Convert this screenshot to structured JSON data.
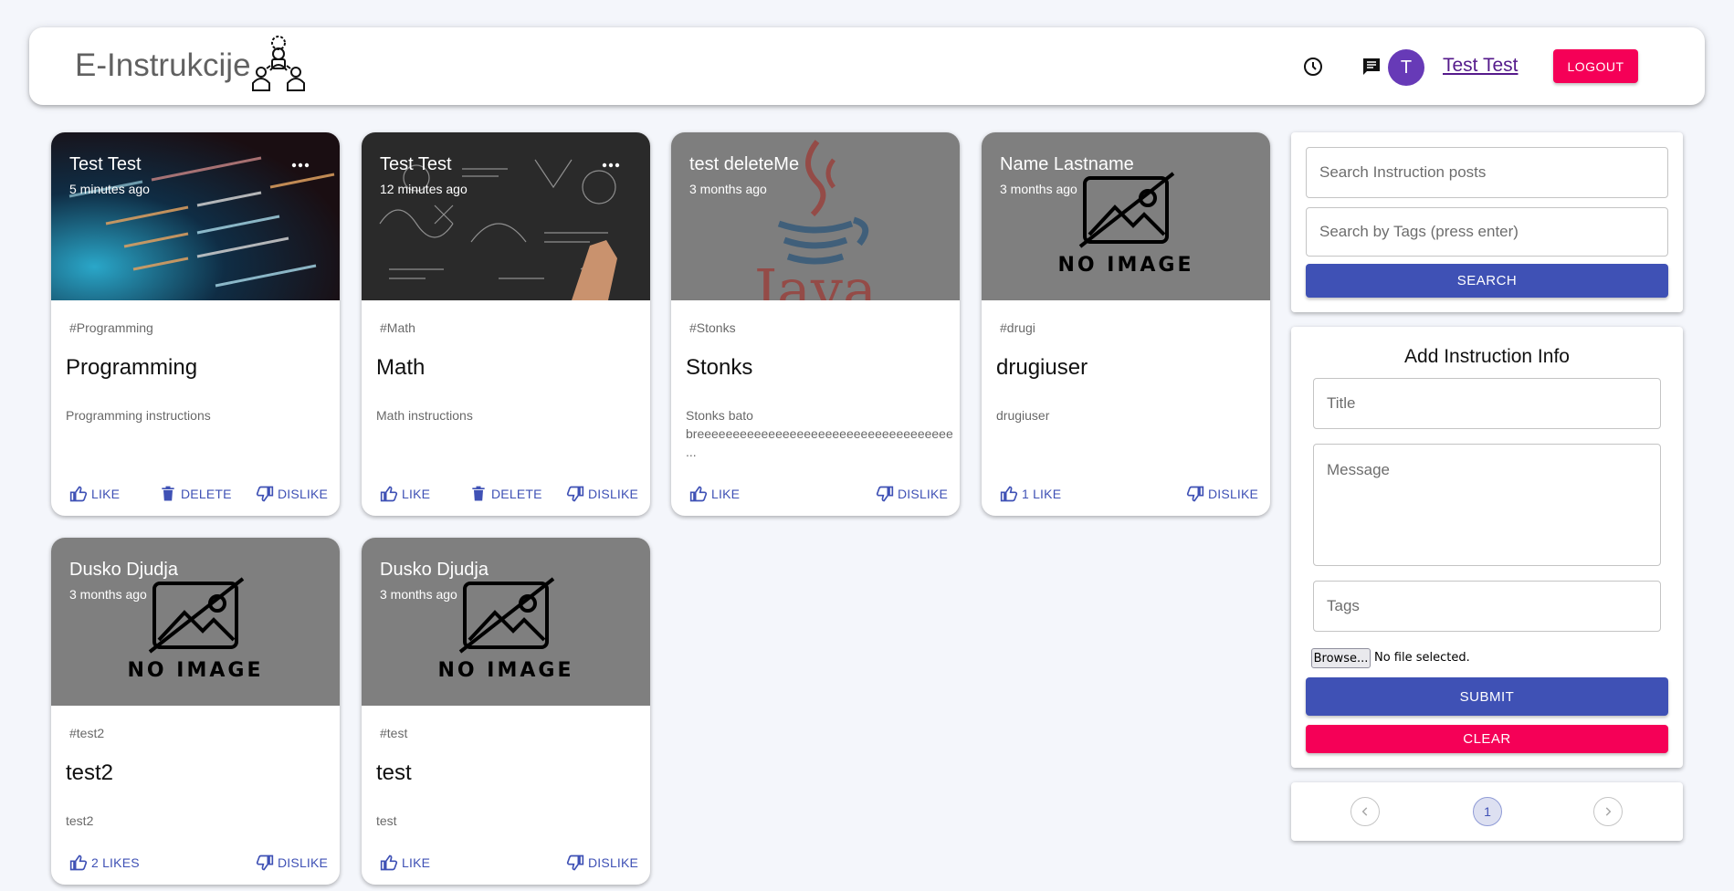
{
  "header": {
    "brand": "E-Instrukcije",
    "avatar_letter": "T",
    "username": "Test Test",
    "logout": "LOGOUT"
  },
  "posts": [
    {
      "author": "Test Test",
      "time": "5 minutes ago",
      "tags": "#Programming",
      "title": "Programming",
      "message": "Programming instructions",
      "like": "LIKE",
      "delete": "DELETE",
      "dislike": "DISLIKE",
      "image": "code-photo"
    },
    {
      "author": "Test Test",
      "time": "12 minutes ago",
      "tags": "#Math",
      "title": "Math",
      "message": "Math instructions",
      "like": "LIKE",
      "delete": "DELETE",
      "dislike": "DISLIKE",
      "image": "chalkboard-photo"
    },
    {
      "author": "test deleteMe",
      "time": "3 months ago",
      "tags": "#Stonks",
      "title": "Stonks",
      "message": "Stonks bato\nbreeeeeeeeeeeeeeeeeeeeeeeeeeeeeeeeeeee\n...",
      "like": "LIKE",
      "dislike": "DISLIKE",
      "image": "java-logo"
    },
    {
      "author": "Name Lastname",
      "time": "3 months ago",
      "tags": "#drugi",
      "title": "drugiuser",
      "message": "drugiuser",
      "like": "1 LIKE",
      "dislike": "DISLIKE",
      "image": "no-image"
    },
    {
      "author": "Dusko Djudja",
      "time": "3 months ago",
      "tags": "#test2",
      "title": "test2",
      "message": "test2",
      "like": "2 LIKES",
      "dislike": "DISLIKE",
      "image": "no-image"
    },
    {
      "author": "Dusko Djudja",
      "time": "3 months ago",
      "tags": "#test",
      "title": "test",
      "message": "test",
      "like": "LIKE",
      "dislike": "DISLIKE",
      "image": "no-image"
    }
  ],
  "no_image_text": "NO IMAGE",
  "java_text": "Java",
  "search": {
    "posts_placeholder": "Search Instruction posts",
    "tags_placeholder": "Search by Tags (press enter)",
    "button": "SEARCH"
  },
  "form": {
    "title": "Add Instruction Info",
    "title_placeholder": "Title",
    "message_placeholder": "Message",
    "tags_placeholder": "Tags",
    "browse": "Browse...",
    "no_file": "No file selected.",
    "submit": "SUBMIT",
    "clear": "CLEAR"
  },
  "pagination": {
    "current": "1"
  },
  "colors": {
    "primary": "#3f51b5",
    "secondary": "#f50057",
    "avatar": "#673ab7",
    "media_gray": "#7f7f7f"
  }
}
